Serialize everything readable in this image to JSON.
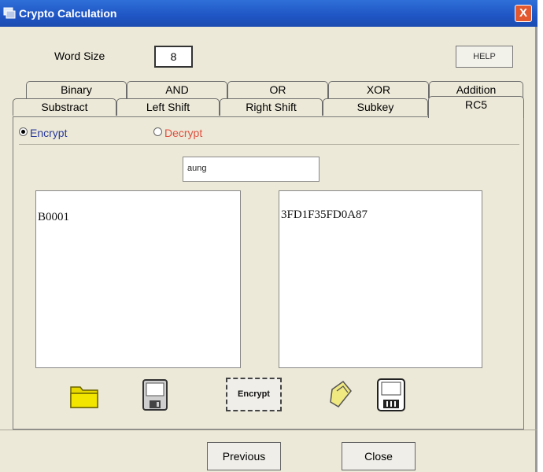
{
  "window": {
    "title": "Crypto Calculation",
    "close_label": "X"
  },
  "header": {
    "word_size_label": "Word Size",
    "word_size_value": "8",
    "help_label": "HELP"
  },
  "tabs_row1": [
    "Binary",
    "AND",
    "OR",
    "XOR",
    "Addition"
  ],
  "tabs_row2": [
    "Substract",
    "Left Shift",
    "Right Shift",
    "Subkey",
    "RC5"
  ],
  "active_tab": "RC5",
  "mode": {
    "encrypt_label": "Encrypt",
    "decrypt_label": "Decrypt",
    "selected": "Encrypt"
  },
  "key_value": "aung",
  "input_text": "B0001",
  "output_text": "3FD1F35FD0A87",
  "toolbar": {
    "encrypt_label": "Encrypt",
    "icons": [
      "open-folder-icon",
      "save-disk-icon",
      "open-folder-icon",
      "save-disk-icon"
    ]
  },
  "footer": {
    "previous_label": "Previous",
    "close_label": "Close"
  },
  "colors": {
    "title_bar": "#1f55c4",
    "decrypt_text": "#e05040",
    "encrypt_text": "#2a3a9a",
    "folder": "#e6d800"
  }
}
